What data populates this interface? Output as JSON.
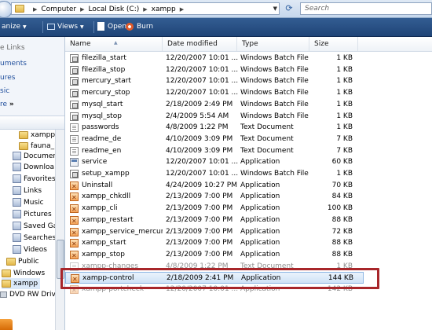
{
  "address": {
    "crumbs": [
      "Computer",
      "Local Disk (C:)",
      "xampp"
    ],
    "search_placeholder": "Search"
  },
  "toolbar": {
    "organize": "anize",
    "views": "Views",
    "open": "Open",
    "burn": "Burn"
  },
  "nav": {
    "favorite_links": [
      {
        "label": "e Links",
        "color": "#6b6b6b"
      },
      {
        "label": "uments",
        "color": "#1f4e9c"
      },
      {
        "label": "ures",
        "color": "#1f4e9c"
      },
      {
        "label": "sic",
        "color": "#1f4e9c"
      },
      {
        "label": "re",
        "color": "#1f4e9c"
      }
    ],
    "more_chevron": "»",
    "tree": [
      {
        "label": "xampp",
        "icon": "folder"
      },
      {
        "label": "fauna_l",
        "icon": "folder"
      },
      {
        "label": "Documer",
        "icon": "docs"
      },
      {
        "label": "Downloa",
        "icon": "docs"
      },
      {
        "label": "Favorites",
        "icon": "docs"
      },
      {
        "label": "Links",
        "icon": "docs"
      },
      {
        "label": "Music",
        "icon": "docs"
      },
      {
        "label": "Pictures",
        "icon": "docs"
      },
      {
        "label": "Saved Ga",
        "icon": "docs"
      },
      {
        "label": "Searches",
        "icon": "docs"
      },
      {
        "label": "Videos",
        "icon": "docs"
      },
      {
        "label": "Public",
        "icon": "folder"
      },
      {
        "label": "Windows",
        "icon": "folder"
      },
      {
        "label": "xampp",
        "icon": "folder"
      },
      {
        "label": "DVD RW Drive",
        "icon": "drive"
      }
    ]
  },
  "columns": {
    "name": "Name",
    "date": "Date modified",
    "type": "Type",
    "size": "Size"
  },
  "files": [
    {
      "name": "filezilla_start",
      "date": "12/20/2007 10:01 ...",
      "type": "Windows Batch File",
      "size": "1 KB",
      "icon": "bat"
    },
    {
      "name": "filezilla_stop",
      "date": "12/20/2007 10:01 ...",
      "type": "Windows Batch File",
      "size": "1 KB",
      "icon": "bat"
    },
    {
      "name": "mercury_start",
      "date": "12/20/2007 10:01 ...",
      "type": "Windows Batch File",
      "size": "1 KB",
      "icon": "bat"
    },
    {
      "name": "mercury_stop",
      "date": "12/20/2007 10:01 ...",
      "type": "Windows Batch File",
      "size": "1 KB",
      "icon": "bat"
    },
    {
      "name": "mysql_start",
      "date": "2/18/2009 2:49 PM",
      "type": "Windows Batch File",
      "size": "1 KB",
      "icon": "bat"
    },
    {
      "name": "mysql_stop",
      "date": "2/4/2009 5:54 AM",
      "type": "Windows Batch File",
      "size": "1 KB",
      "icon": "bat"
    },
    {
      "name": "passwords",
      "date": "4/8/2009 1:22 PM",
      "type": "Text Document",
      "size": "1 KB",
      "icon": "txt"
    },
    {
      "name": "readme_de",
      "date": "4/10/2009 3:09 PM",
      "type": "Text Document",
      "size": "7 KB",
      "icon": "txt"
    },
    {
      "name": "readme_en",
      "date": "4/10/2009 3:09 PM",
      "type": "Text Document",
      "size": "7 KB",
      "icon": "txt"
    },
    {
      "name": "service",
      "date": "12/20/2007 10:01 ...",
      "type": "Application",
      "size": "60 KB",
      "icon": "svc"
    },
    {
      "name": "setup_xampp",
      "date": "12/20/2007 10:01 ...",
      "type": "Windows Batch File",
      "size": "1 KB",
      "icon": "bat"
    },
    {
      "name": "Uninstall",
      "date": "4/24/2009 10:27 PM",
      "type": "Application",
      "size": "70 KB",
      "icon": "app"
    },
    {
      "name": "xampp_chkdll",
      "date": "2/13/2009 7:00 PM",
      "type": "Application",
      "size": "84 KB",
      "icon": "app"
    },
    {
      "name": "xampp_cli",
      "date": "2/13/2009 7:00 PM",
      "type": "Application",
      "size": "100 KB",
      "icon": "app"
    },
    {
      "name": "xampp_restart",
      "date": "2/13/2009 7:00 PM",
      "type": "Application",
      "size": "88 KB",
      "icon": "app"
    },
    {
      "name": "xampp_service_mercury",
      "date": "2/13/2009 7:00 PM",
      "type": "Application",
      "size": "72 KB",
      "icon": "app"
    },
    {
      "name": "xampp_start",
      "date": "2/13/2009 7:00 PM",
      "type": "Application",
      "size": "88 KB",
      "icon": "app"
    },
    {
      "name": "xampp_stop",
      "date": "2/13/2009 7:00 PM",
      "type": "Application",
      "size": "88 KB",
      "icon": "app"
    },
    {
      "name": "xampp-changes",
      "date": "4/8/2009 1:22 PM",
      "type": "Text Document",
      "size": "1 KB",
      "icon": "txt",
      "faded": true
    },
    {
      "name": "xampp-control",
      "date": "2/18/2009 2:41 PM",
      "type": "Application",
      "size": "144 KB",
      "icon": "app",
      "selected": true
    },
    {
      "name": "xampp-portcheck",
      "date": "12/20/2007 10:01 ...",
      "type": "Application",
      "size": "142 KB",
      "icon": "app",
      "faded": true
    }
  ],
  "colors": {
    "highlight_box": "#a8262a",
    "toolbar_bg": "#2a5086",
    "link_blue": "#1f4e9c"
  }
}
